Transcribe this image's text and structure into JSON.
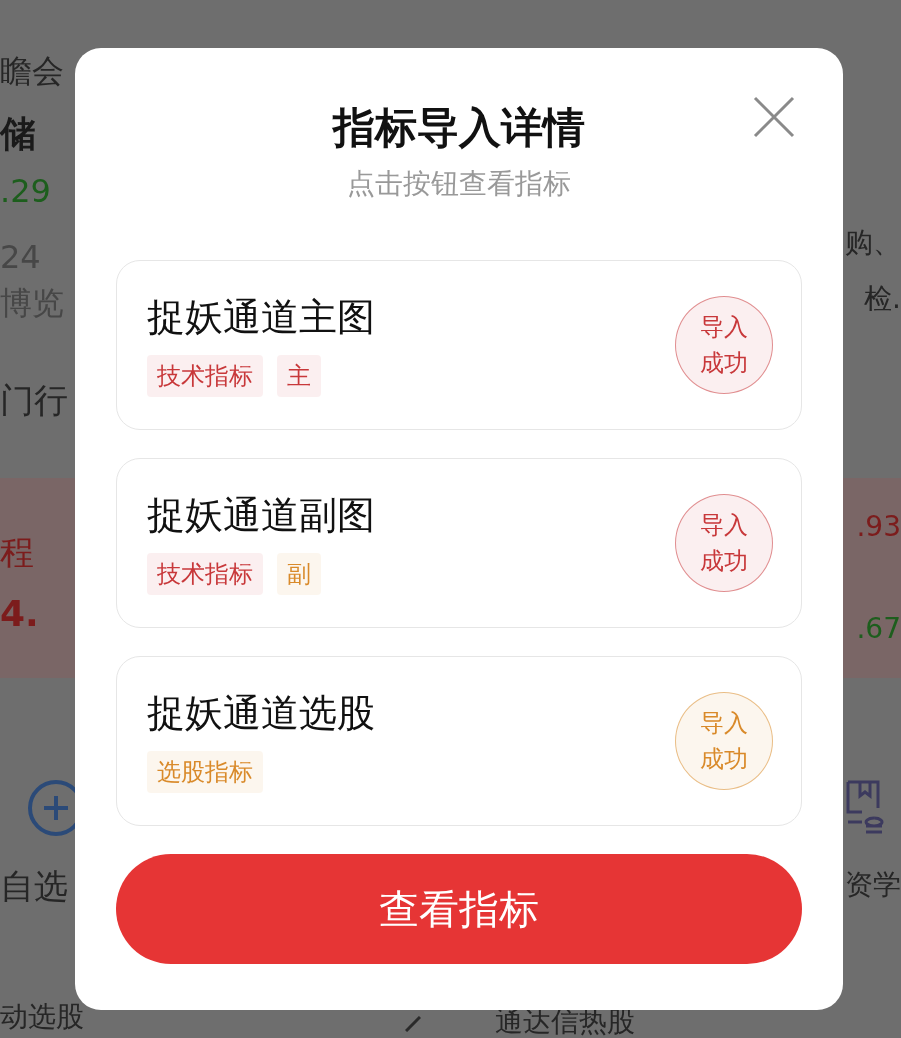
{
  "background": {
    "left": [
      {
        "text": "瞻会",
        "color": "#262626"
      },
      {
        "text": "储",
        "color": "#1a1a1a"
      },
      {
        "text": ".29",
        "color": "#1d5e1d"
      },
      {
        "text": "24",
        "color": "#474747"
      },
      {
        "text": "博览",
        "color": "#474747"
      },
      {
        "text": "门行",
        "color": "#262626"
      },
      {
        "text": "程",
        "color": "#7c1c1c"
      },
      {
        "text": "4.",
        "color": "#7c1c1c"
      },
      {
        "text": "自选",
        "color": "#262626"
      },
      {
        "text": "动选股",
        "color": "#262626"
      }
    ],
    "right": [
      {
        "text": "购、",
        "color": "#262626"
      },
      {
        "text": "检.",
        "color": "#262626"
      },
      {
        "text": ".93",
        "color": "#7c1c1c"
      },
      {
        "text": ".67",
        "color": "#1d5e1d"
      },
      {
        "text": "资学",
        "color": "#262626"
      }
    ],
    "bottom": [
      {
        "text": "通达信热股",
        "color": "#262626"
      }
    ]
  },
  "dialog": {
    "title": "指标导入详情",
    "subtitle": "点击按钮查看指标",
    "items": [
      {
        "name": "捉妖通道主图",
        "tags": [
          {
            "label": "技术指标",
            "color": "#c8383a"
          },
          {
            "label": "主",
            "color": "#c8383a"
          }
        ],
        "status": "导入成功",
        "color": "#c8383a"
      },
      {
        "name": "捉妖通道副图",
        "tags": [
          {
            "label": "技术指标",
            "color": "#c8383a"
          },
          {
            "label": "副",
            "color": "#d98a2a"
          }
        ],
        "status": "导入成功",
        "color": "#c8383a"
      },
      {
        "name": "捉妖通道选股",
        "tags": [
          {
            "label": "选股指标",
            "color": "#d98a2a"
          }
        ],
        "status": "导入成功",
        "color": "#d98a2a"
      }
    ],
    "button": "查看指标"
  }
}
